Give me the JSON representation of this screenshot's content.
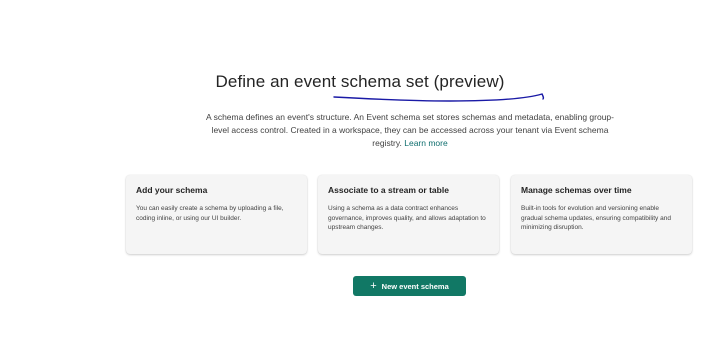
{
  "header": {
    "title": "Define an event schema set (preview)",
    "description": "A schema defines an event's structure. An Event schema set stores schemas and metadata, enabling group-level access control. Created in a workspace, they can be accessed across your tenant via Event schema registry.",
    "learn_more": "Learn more"
  },
  "cards": [
    {
      "title": "Add your schema",
      "body": "You can easily create a schema by uploading a file, coding inline, or using our UI builder."
    },
    {
      "title": "Associate to a stream or table",
      "body": "Using a schema as a data contract enhances governance, improves quality, and allows adaptation to upstream changes."
    },
    {
      "title": "Manage schemas over time",
      "body": "Built-in tools for evolution and versioning enable gradual schema updates, ensuring compatibility and minimizing disruption."
    }
  ],
  "action": {
    "icon": "plus-icon",
    "label": "New event schema"
  },
  "colors": {
    "accent": "#117865",
    "link": "#0f6e6e",
    "annotation": "#1a1aa6"
  }
}
